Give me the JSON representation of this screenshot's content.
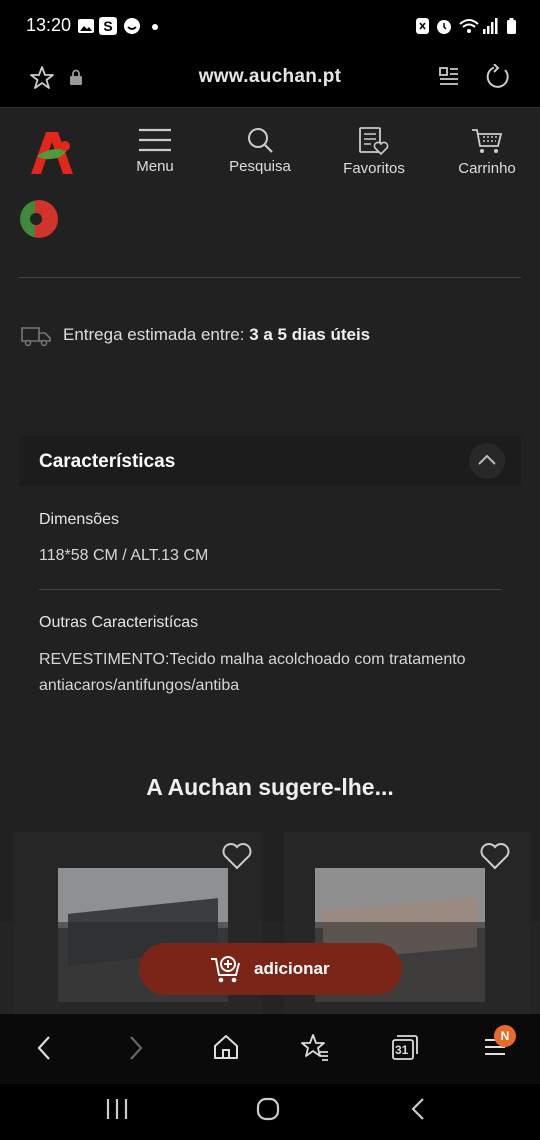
{
  "status_bar": {
    "time": "13:20",
    "left_icons": [
      "gallery-icon",
      "s-app-icon",
      "face-icon",
      "dot-icon"
    ],
    "right_icons": [
      "nfc-icon",
      "alarm-icon",
      "wifi-icon",
      "signal-icon",
      "battery-icon"
    ]
  },
  "browser": {
    "url": "www.auchan.pt",
    "left_icons": [
      "star-icon",
      "lock-icon"
    ],
    "right_icons": [
      "reader-mode-icon",
      "refresh-icon"
    ]
  },
  "header": {
    "logo": "auchan-logo",
    "nav": [
      {
        "label": "Menu",
        "icon": "menu-icon"
      },
      {
        "label": "Pesquisa",
        "icon": "search-icon"
      },
      {
        "label": "Favoritos",
        "icon": "favorites-icon"
      },
      {
        "label": "Carrinho",
        "icon": "cart-icon"
      }
    ]
  },
  "delivery": {
    "prefix": "Entrega estimada entre:",
    "value": "3 a 5 dias úteis"
  },
  "characteristics": {
    "title": "Características",
    "items": [
      {
        "label": "Dimensões",
        "value": "118*58 CM / ALT.13 CM"
      },
      {
        "label": "Outras Caracteristícas",
        "value": "REVESTIMENTO:Tecido malha acolchoado com tratamento antiacaros/antifungos/antiba"
      }
    ]
  },
  "suggestions": {
    "title": "A Auchan sugere-lhe..."
  },
  "add_button": {
    "label": "adicionar"
  },
  "bottom_bar": {
    "tabs_count": "31",
    "badge": "N"
  },
  "colors": {
    "page_bg": "#212121",
    "accent_red": "#7b2518",
    "logo_red": "#e1261c",
    "logo_green": "#4f9a3c"
  }
}
